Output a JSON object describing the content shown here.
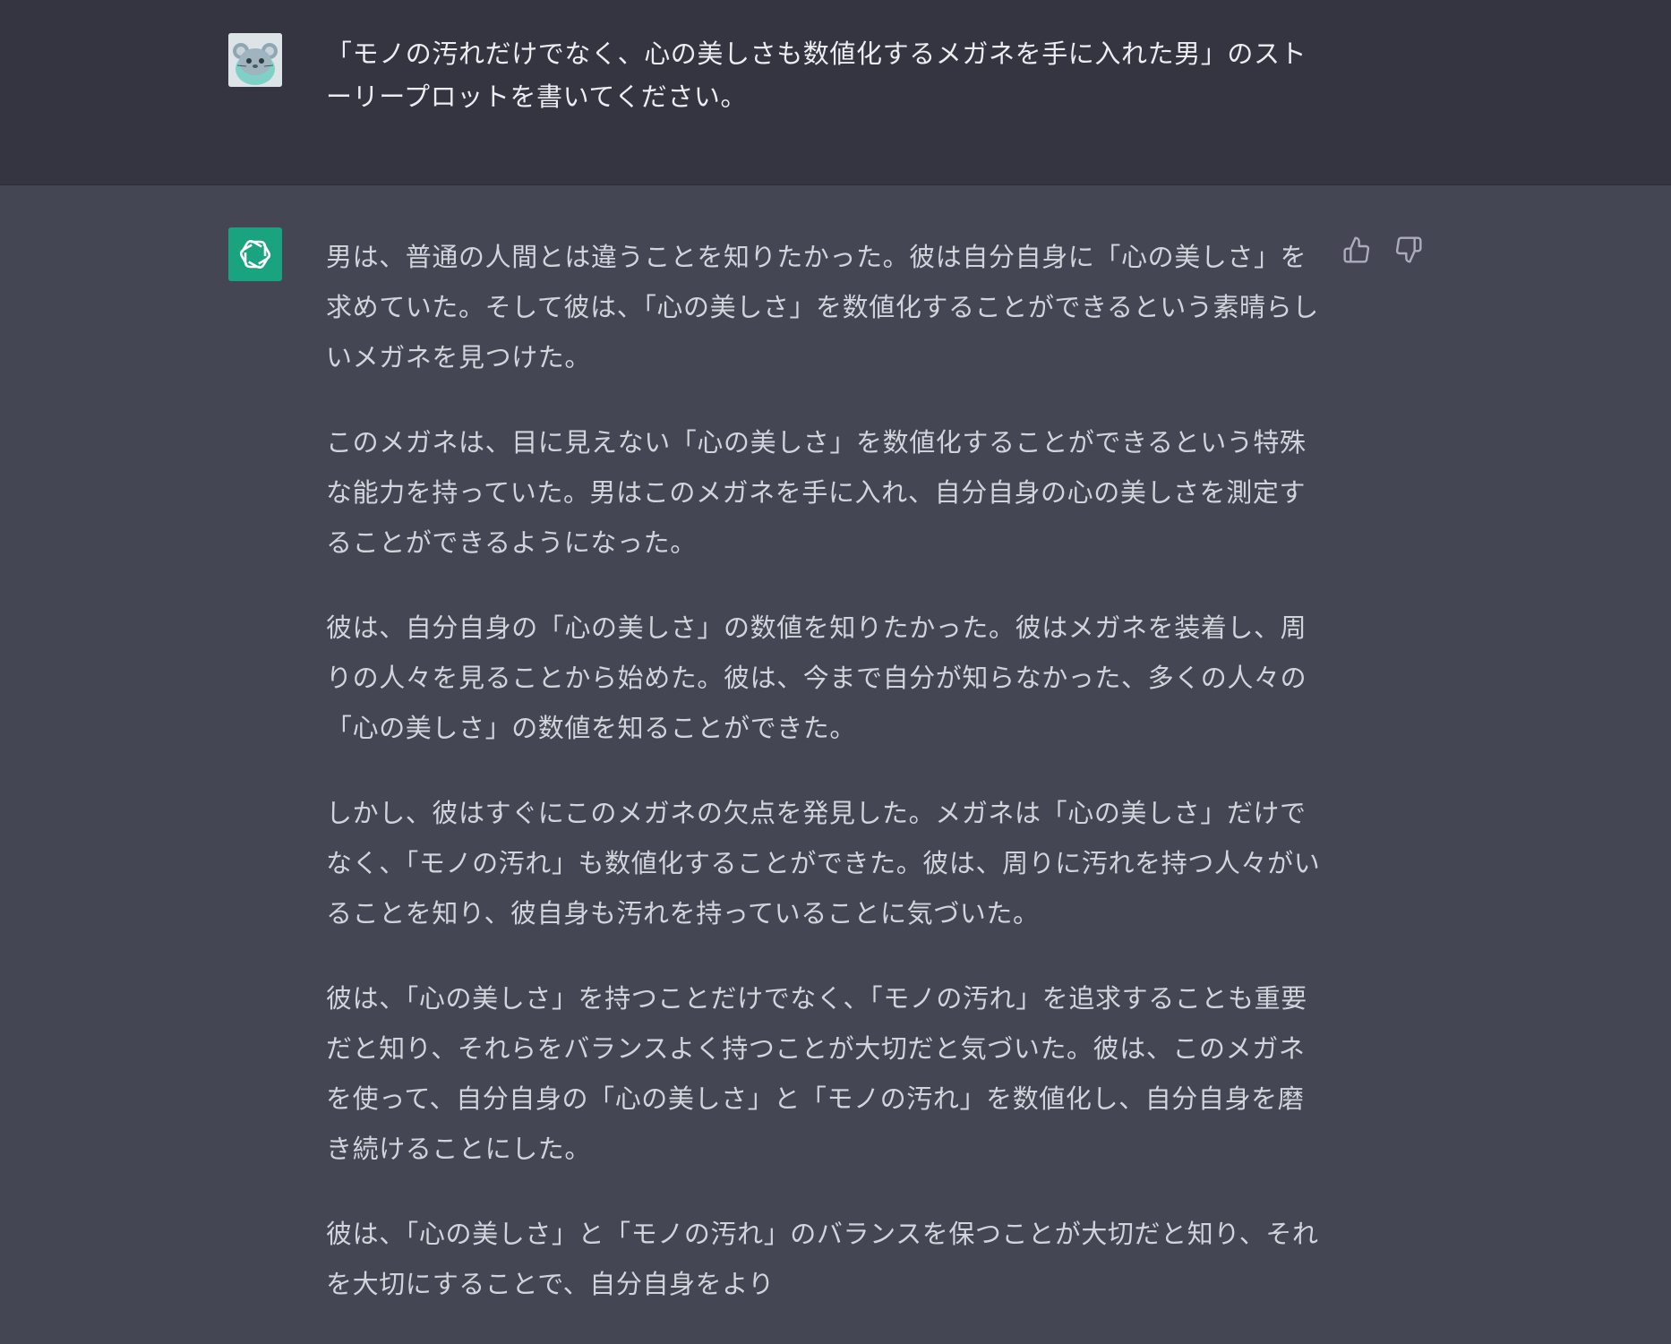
{
  "user": {
    "message": "「モノの汚れだけでなく、心の美しさも数値化するメガネを手に入れた男」のストーリープロットを書いてください。"
  },
  "assistant": {
    "paragraphs": [
      "男は、普通の人間とは違うことを知りたかった。彼は自分自身に「心の美しさ」を求めていた。そして彼は、「心の美しさ」を数値化することができるという素晴らしいメガネを見つけた。",
      "このメガネは、目に見えない「心の美しさ」を数値化することができるという特殊な能力を持っていた。男はこのメガネを手に入れ、自分自身の心の美しさを測定することができるようになった。",
      "彼は、自分自身の「心の美しさ」の数値を知りたかった。彼はメガネを装着し、周りの人々を見ることから始めた。彼は、今まで自分が知らなかった、多くの人々の「心の美しさ」の数値を知ることができた。",
      "しかし、彼はすぐにこのメガネの欠点を発見した。メガネは「心の美しさ」だけでなく、「モノの汚れ」も数値化することができた。彼は、周りに汚れを持つ人々がいることを知り、彼自身も汚れを持っていることに気づいた。",
      "彼は、「心の美しさ」を持つことだけでなく、「モノの汚れ」を追求することも重要だと知り、それらをバランスよく持つことが大切だと気づいた。彼は、このメガネを使って、自分自身の「心の美しさ」と「モノの汚れ」を数値化し、自分自身を磨き続けることにした。",
      "彼は、「心の美しさ」と「モノの汚れ」のバランスを保つことが大切だと知り、それを大切にすることで、自分自身をより"
    ]
  },
  "icons": {
    "user_avatar": "hamster-avatar-icon",
    "assistant_avatar": "openai-logo-icon",
    "thumbs_up": "thumbs-up-icon",
    "thumbs_down": "thumbs-down-icon"
  },
  "colors": {
    "user_bg": "#343541",
    "assistant_bg": "#444654",
    "assistant_avatar_bg": "#19a37f",
    "text": "#d1d5db"
  }
}
